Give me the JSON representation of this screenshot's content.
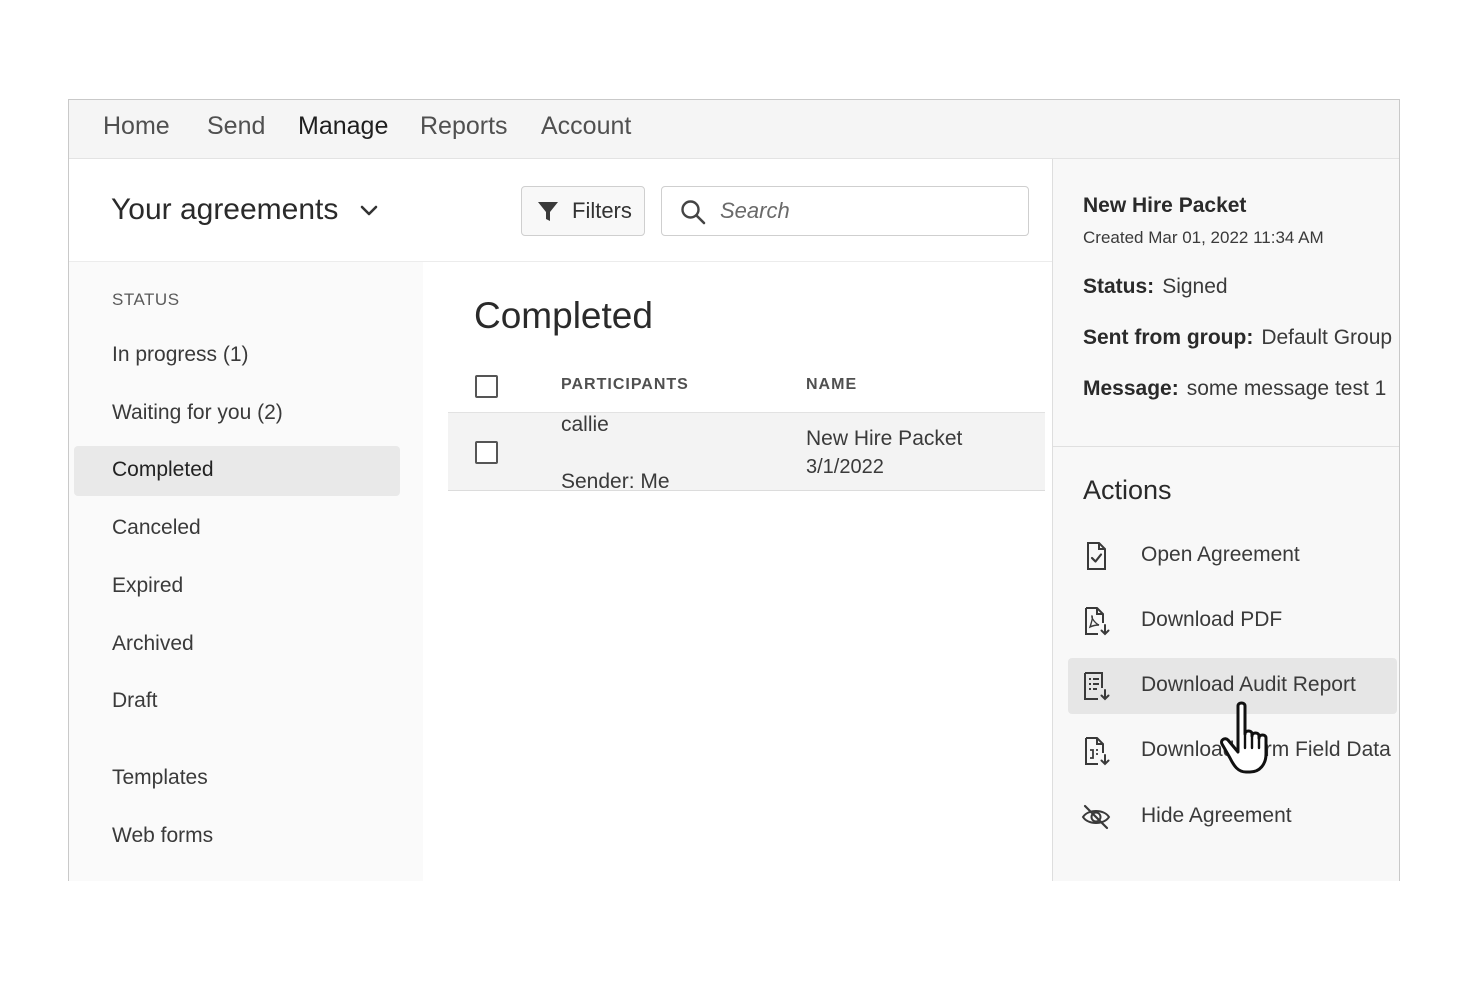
{
  "nav": {
    "items": [
      {
        "label": "Home"
      },
      {
        "label": "Send"
      },
      {
        "label": "Manage",
        "active": true
      },
      {
        "label": "Reports"
      },
      {
        "label": "Account"
      }
    ]
  },
  "header": {
    "title": "Your agreements",
    "filters_label": "Filters",
    "search_placeholder": "Search"
  },
  "sidebar": {
    "status_label": "STATUS",
    "items": [
      {
        "label": "In progress (1)"
      },
      {
        "label": "Waiting for you (2)"
      },
      {
        "label": "Completed",
        "selected": true
      },
      {
        "label": "Canceled"
      },
      {
        "label": "Expired"
      },
      {
        "label": "Archived"
      },
      {
        "label": "Draft"
      },
      {
        "label": "Templates"
      },
      {
        "label": "Web forms"
      }
    ]
  },
  "main": {
    "title": "Completed",
    "columns": {
      "participants": "PARTICIPANTS",
      "name": "NAME"
    },
    "rows": [
      {
        "participant": "callie",
        "sender": "Sender: Me",
        "name": "New Hire Packet",
        "date": "3/1/2022"
      }
    ]
  },
  "details": {
    "title": "New Hire Packet",
    "created": "Created Mar 01, 2022 11:34 AM",
    "status_key": "Status:",
    "status_value": "Signed",
    "group_key": "Sent from group:",
    "group_value": "Default Group",
    "message_key": "Message:",
    "message_value": "some message test 1"
  },
  "actions": {
    "title": "Actions",
    "items": [
      {
        "label": "Open Agreement",
        "icon": "document-check-icon"
      },
      {
        "label": "Download PDF",
        "icon": "pdf-download-icon"
      },
      {
        "label": "Download Audit Report",
        "icon": "audit-report-download-icon",
        "hovered": true
      },
      {
        "label": "Download Form Field Data",
        "icon": "form-data-download-icon"
      },
      {
        "label": "Hide Agreement",
        "icon": "eye-hidden-icon"
      }
    ]
  },
  "colors": {
    "selected_bg": "#e9e9e9",
    "hover_bg": "#e6e6e6",
    "text": "#2c2c2c"
  }
}
